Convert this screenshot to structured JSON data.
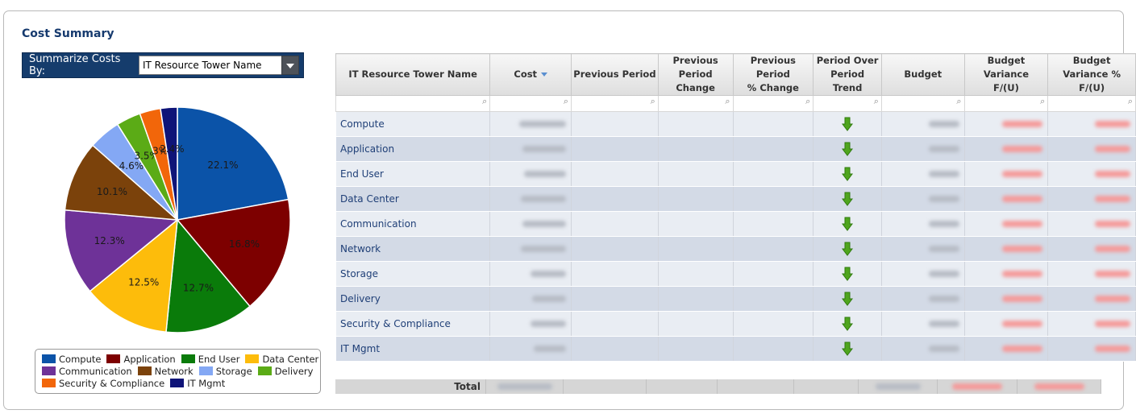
{
  "header": {
    "title": "Cost Summary"
  },
  "summarize": {
    "label": "Summarize Costs By:",
    "selected": "IT Resource Tower Name"
  },
  "colors": {
    "Compute": "#0b53a8",
    "Application": "#7d0000",
    "End User": "#0a7b0a",
    "Data Center": "#fdbc0b",
    "Communication": "#6e3298",
    "Network": "#7b420b",
    "Storage": "#84a8f4",
    "Delivery": "#5bab16",
    "Security & Compliance": "#f2660a",
    "IT Mgmt": "#0f1478"
  },
  "chart_data": {
    "type": "pie",
    "categories": [
      "Compute",
      "Application",
      "End User",
      "Data Center",
      "Communication",
      "Network",
      "Storage",
      "Delivery",
      "Security & Compliance",
      "IT Mgmt"
    ],
    "values": [
      22.1,
      16.8,
      12.7,
      12.5,
      12.3,
      10.1,
      4.6,
      3.5,
      3.0,
      2.4
    ],
    "labels": [
      "22.1%",
      "16.8%",
      "12.7%",
      "12.5%",
      "12.3%",
      "10.1%",
      "4.6%",
      "3.5%",
      "3%",
      "2.4%"
    ],
    "legend": "bottom"
  },
  "legend": {
    "row1": [
      "Compute",
      "Application",
      "End User",
      "Data Center"
    ],
    "row2": [
      "Communication",
      "Network",
      "Storage",
      "Delivery"
    ],
    "row3": [
      "Security & Compliance",
      "IT Mgmt"
    ]
  },
  "table": {
    "columns": [
      [
        "IT Resource Tower Name"
      ],
      [
        "Cost"
      ],
      [
        "Previous Period"
      ],
      [
        "Previous Period",
        "Change"
      ],
      [
        "Previous Period",
        "% Change"
      ],
      [
        "Period Over",
        "Period Trend"
      ],
      [
        "Budget"
      ],
      [
        "Budget Variance",
        "F/(U)"
      ],
      [
        "Budget Variance %",
        "F/(U)"
      ]
    ],
    "rows": [
      "Compute",
      "Application",
      "End User",
      "Data Center",
      "Communication",
      "Network",
      "Storage",
      "Delivery",
      "Security & Compliance",
      "IT Mgmt"
    ],
    "trend": "down",
    "total_label": "Total"
  }
}
